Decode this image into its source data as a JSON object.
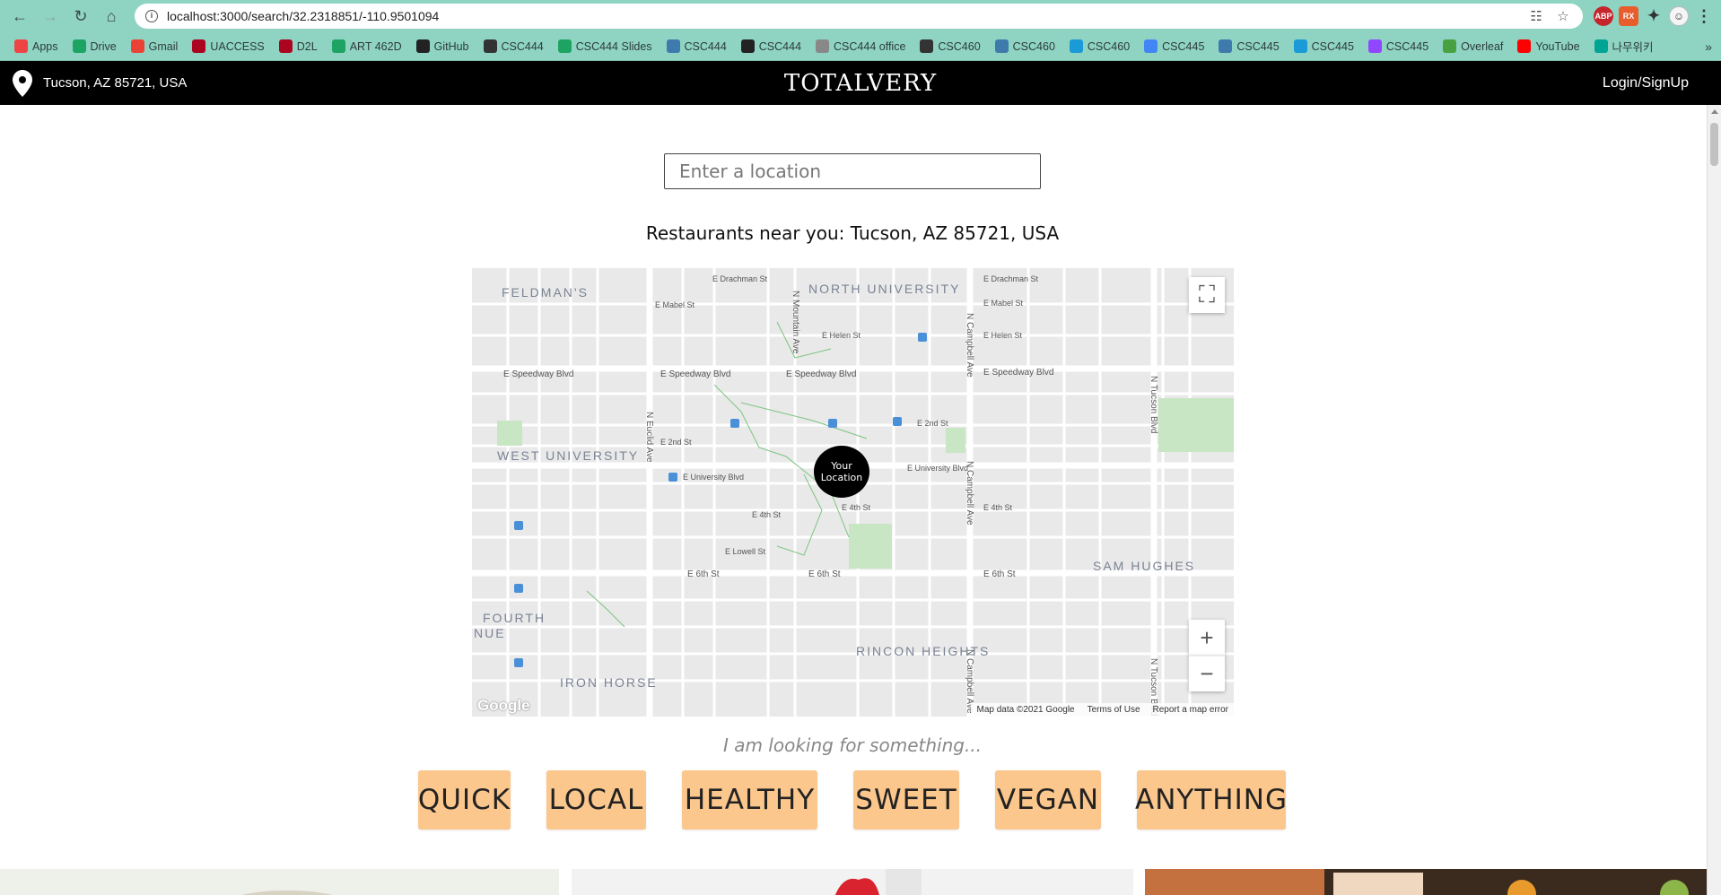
{
  "browser": {
    "url": "localhost:3000/search/32.2318851/-110.9501094",
    "extensions": [
      "ABP",
      "RX"
    ],
    "bookmarks": [
      {
        "label": "Apps",
        "icon": "apps-grid-icon",
        "color": "#e44"
      },
      {
        "label": "Drive",
        "icon": "drive-icon",
        "color": "#1da462"
      },
      {
        "label": "Gmail",
        "icon": "gmail-icon",
        "color": "#ea4335"
      },
      {
        "label": "UACCESS",
        "icon": "ua-logo-icon",
        "color": "#ab0520"
      },
      {
        "label": "D2L",
        "icon": "ua-logo-icon",
        "color": "#ab0520"
      },
      {
        "label": "ART 462D",
        "icon": "drive-icon",
        "color": "#1da462"
      },
      {
        "label": "GitHub",
        "icon": "github-icon",
        "color": "#222"
      },
      {
        "label": "CSC444",
        "icon": "globe-icon",
        "color": "#333"
      },
      {
        "label": "CSC444 Slides",
        "icon": "drive-icon",
        "color": "#1da462"
      },
      {
        "label": "CSC444",
        "icon": "piazza-icon",
        "color": "#3e7aab"
      },
      {
        "label": "CSC444",
        "icon": "github-icon",
        "color": "#222"
      },
      {
        "label": "CSC444 office",
        "icon": "doc-icon",
        "color": "#888"
      },
      {
        "label": "CSC460",
        "icon": "globe-icon",
        "color": "#333"
      },
      {
        "label": "CSC460",
        "icon": "piazza-icon",
        "color": "#3e7aab"
      },
      {
        "label": "CSC460",
        "icon": "chart-icon",
        "color": "#1a9bd7"
      },
      {
        "label": "CSC445",
        "icon": "docs-icon",
        "color": "#4285f4"
      },
      {
        "label": "CSC445",
        "icon": "piazza-icon",
        "color": "#3e7aab"
      },
      {
        "label": "CSC445",
        "icon": "chart-icon",
        "color": "#1a9bd7"
      },
      {
        "label": "CSC445",
        "icon": "twitch-icon",
        "color": "#9146ff"
      },
      {
        "label": "Overleaf",
        "icon": "overleaf-icon",
        "color": "#47a141"
      },
      {
        "label": "YouTube",
        "icon": "youtube-icon",
        "color": "#ff0000"
      },
      {
        "label": "나무위키",
        "icon": "namu-icon",
        "color": "#00a495"
      }
    ]
  },
  "header": {
    "location": "Tucson, AZ 85721, USA",
    "brand": "TOTALVERY",
    "login": "Login/SignUp"
  },
  "search": {
    "placeholder": "Enter a location"
  },
  "near_text": "Restaurants near you: Tucson, AZ 85721, USA",
  "map": {
    "marker": "Your Location",
    "marker_lines": [
      "Your",
      "Location"
    ],
    "neighborhoods": [
      "FELDMAN'S",
      "NORTH UNIVERSITY",
      "WEST UNIVERSITY",
      "SAM HUGHES",
      "FOURTH",
      "NUE",
      "IRON HORSE",
      "RINCON HEIGHTS"
    ],
    "streets": {
      "speedway": "E Speedway Blvd",
      "sixth": "E 6th St",
      "campbell": "N Campbell Ave",
      "euclid": "N Euclid Ave",
      "mountain": "N Mountain Ave",
      "tucson": "N Tucson Blvd",
      "university": "E University Blvd",
      "fourth": "E 4th St",
      "lowell": "E Lowell St",
      "second": "E 2nd St",
      "drachman": "E Drachman St",
      "helen": "E Helen St",
      "mabel": "E Mabel St"
    },
    "footer": [
      "Map data ©2021 Google",
      "Terms of Use",
      "Report a map error"
    ],
    "google": "Google"
  },
  "looking_for": "I am looking for something...",
  "categories": [
    "QUICK",
    "LOCAL",
    "HEALTHY",
    "SWEET",
    "VEGAN",
    "ANYTHING"
  ],
  "colors": {
    "chrome": "#8fd4c3",
    "header_bg": "#000000",
    "category_bg": "#fbc78d",
    "park": "#c8e6c4"
  }
}
